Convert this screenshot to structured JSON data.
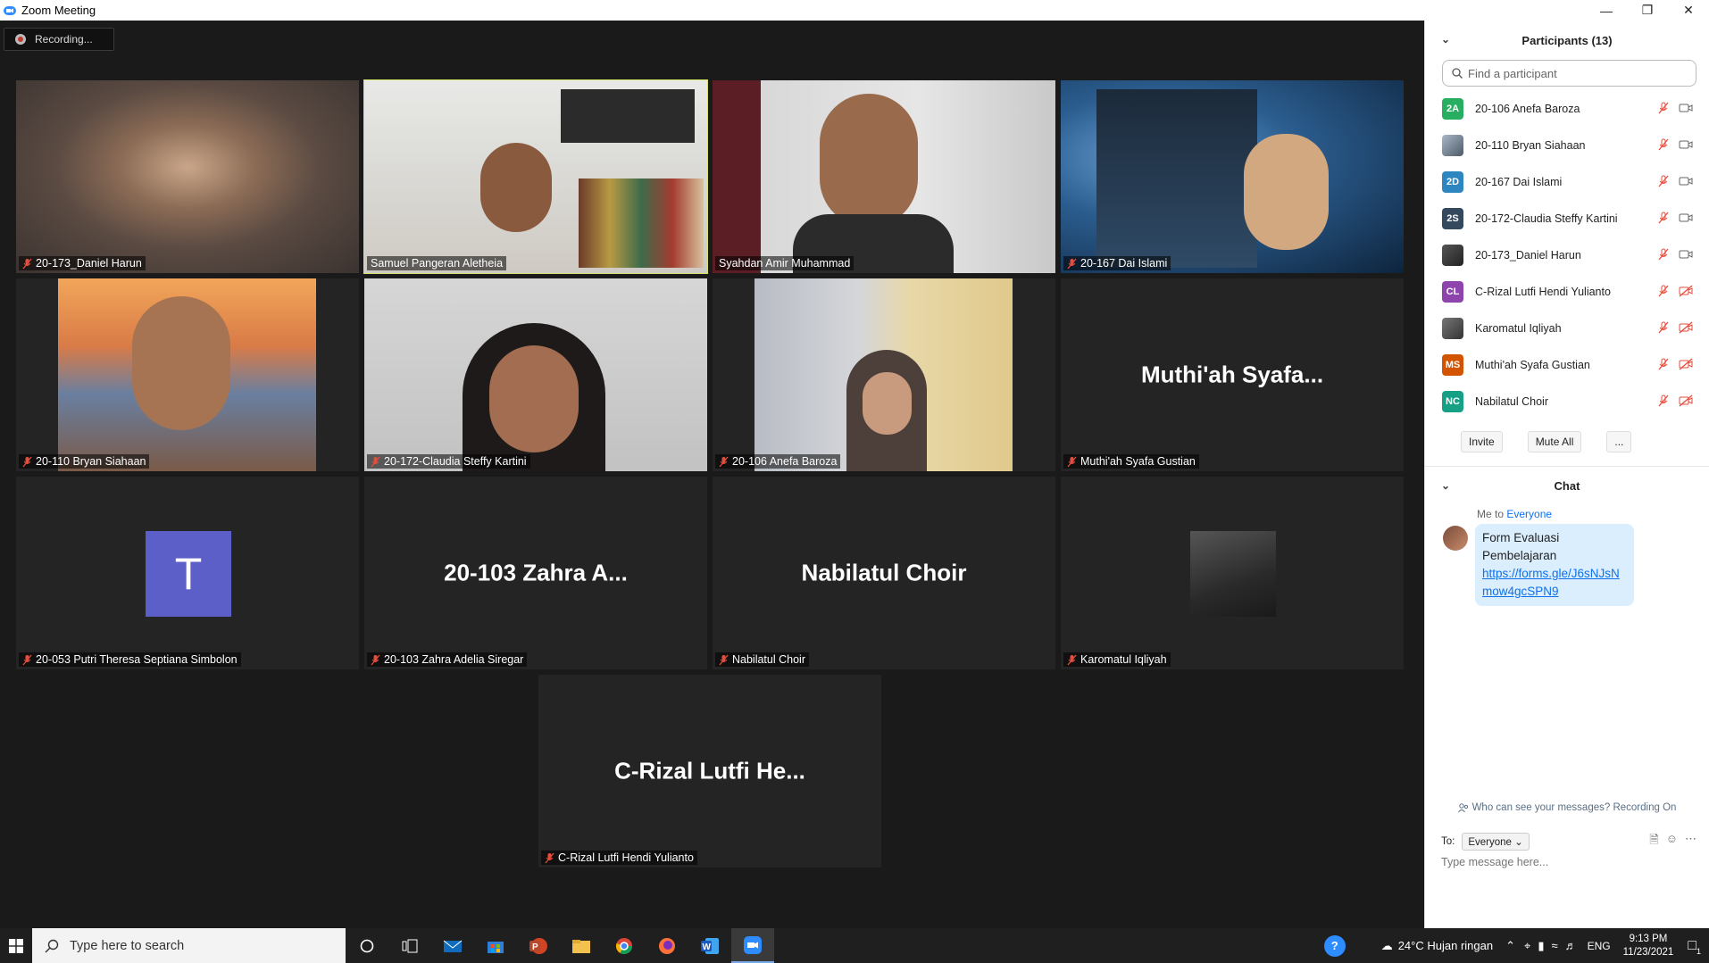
{
  "window": {
    "title": "Zoom Meeting"
  },
  "recording": {
    "label": "Recording..."
  },
  "tiles": [
    {
      "name": "20-173_Daniel Harun",
      "muted": true
    },
    {
      "name": "Samuel Pangeran Aletheia",
      "muted": false,
      "active_speaker": true
    },
    {
      "name": "Syahdan Amir Muhammad",
      "muted": false
    },
    {
      "name": "20-167 Dai Islami",
      "muted": true
    },
    {
      "name": "20-110 Bryan Siahaan",
      "muted": true
    },
    {
      "name": "20-172-Claudia Steffy Kartini",
      "muted": true
    },
    {
      "name": "20-106 Anefa Baroza",
      "muted": true
    },
    {
      "name": "Muthi'ah Syafa Gustian",
      "display": "Muthi'ah Syafa...",
      "muted": true
    },
    {
      "name": "20-053 Putri Theresa Septiana Simbolon",
      "avatar_letter": "T",
      "muted": true
    },
    {
      "name": "20-103 Zahra Adelia Siregar",
      "display": "20-103  Zahra A...",
      "muted": true
    },
    {
      "name": "Nabilatul Choir",
      "display": "Nabilatul Choir",
      "muted": true
    },
    {
      "name": "Karomatul Iqliyah",
      "muted": true
    },
    {
      "name": "C-Rizal Lutfi Hendi Yulianto",
      "display": "C-Rizal Lutfi He...",
      "muted": true
    }
  ],
  "participants": {
    "title": "Participants (13)",
    "search_placeholder": "Find a participant",
    "items": [
      {
        "initials": "2A",
        "name": "20-106 Anefa Baroza",
        "color": "#27ae60",
        "video_off": false
      },
      {
        "initials": "",
        "name": "20-110 Bryan Siahaan",
        "color": "#7f8c9a",
        "video_off": false
      },
      {
        "initials": "2D",
        "name": "20-167 Dai Islami",
        "color": "#2e86c1",
        "video_off": false
      },
      {
        "initials": "2S",
        "name": "20-172-Claudia Steffy Kartini",
        "color": "#34495e",
        "video_off": false
      },
      {
        "initials": "",
        "name": "20-173_Daniel Harun",
        "color": "#444444",
        "video_off": false
      },
      {
        "initials": "CL",
        "name": "C-Rizal Lutfi Hendi Yulianto",
        "color": "#8e44ad",
        "video_off": true
      },
      {
        "initials": "",
        "name": "Karomatul Iqliyah",
        "color": "#555555",
        "video_off": true
      },
      {
        "initials": "MS",
        "name": "Muthi'ah Syafa Gustian",
        "color": "#d35400",
        "video_off": true
      },
      {
        "initials": "NC",
        "name": "Nabilatul Choir",
        "color": "#16a085",
        "video_off": true
      }
    ],
    "invite_label": "Invite",
    "mute_all_label": "Mute All",
    "more_label": "..."
  },
  "chat": {
    "title": "Chat",
    "meta_prefix": "Me to",
    "meta_to": "Everyone",
    "message_text_1": "Form Evaluasi",
    "message_text_2": "Pembelajaran",
    "message_link": "https://forms.gle/J6sNJsNmow4gcSPN9",
    "who_can_see": "Who can see your messages? Recording On",
    "to_label": "To:",
    "to_value": "Everyone",
    "input_placeholder": "Type message here..."
  },
  "taskbar": {
    "search_placeholder": "Type here to search",
    "weather": "24°C  Hujan ringan",
    "lang": "ENG",
    "time": "9:13 PM",
    "date": "11/23/2021",
    "notification_count": "1"
  }
}
